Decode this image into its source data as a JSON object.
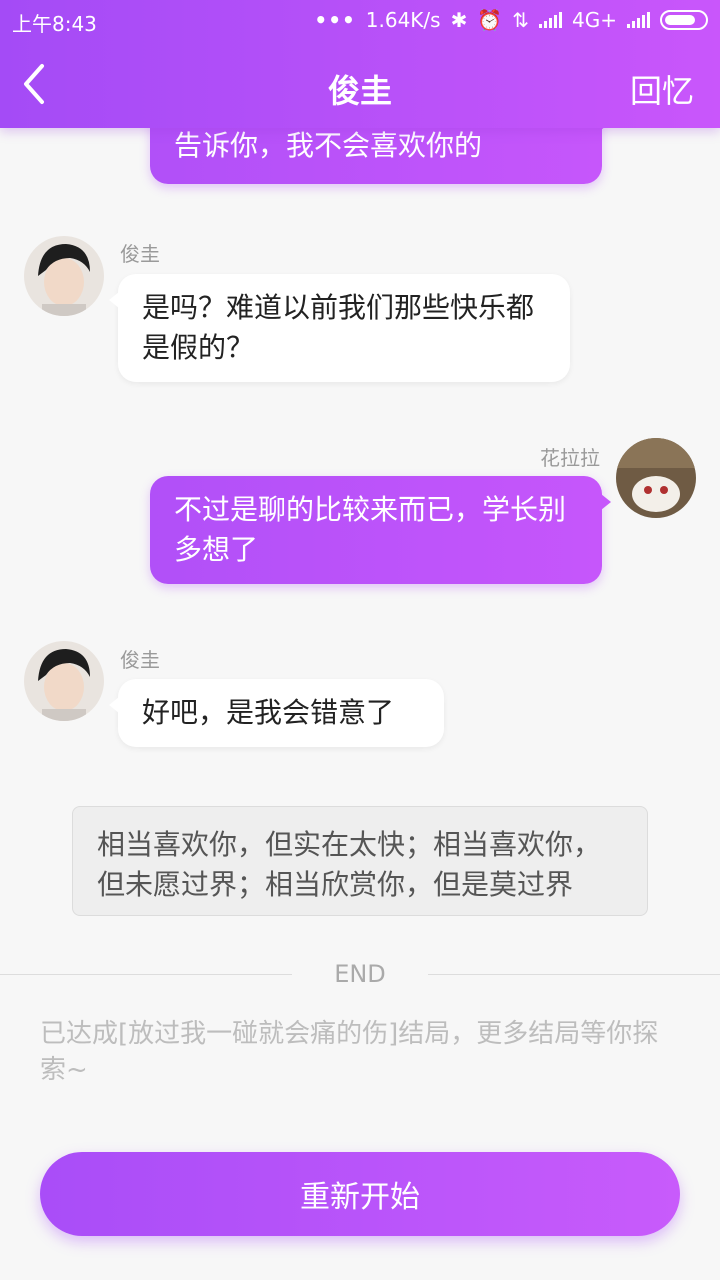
{
  "status_bar": {
    "time": "上午8:43",
    "dots": "•••",
    "speed": "1.64K/s",
    "network": "4G+"
  },
  "nav": {
    "title": "俊圭",
    "right_label": "回忆"
  },
  "messages": [
    {
      "side": "right",
      "text": "告诉你，我不会喜欢你的"
    },
    {
      "side": "left",
      "sender": "俊圭",
      "text": "是吗？难道以前我们那些快乐都是假的？"
    },
    {
      "side": "right",
      "sender": "花拉拉",
      "text": "不过是聊的比较来而已，学长别多想了"
    },
    {
      "side": "left",
      "sender": "俊圭",
      "text": "好吧，是我会错意了"
    }
  ],
  "narration": "相当喜欢你，但实在太快；相当喜欢你，但未愿过界；相当欣赏你，但是莫过界",
  "end_label": "END",
  "ending_text": "已达成[放过我一碰就会痛的伤]结局，更多结局等你探索~",
  "restart_label": "重新开始",
  "colors": {
    "accent": "#b150f8",
    "accent_light": "#c956fb",
    "background": "#f7f7f7"
  }
}
